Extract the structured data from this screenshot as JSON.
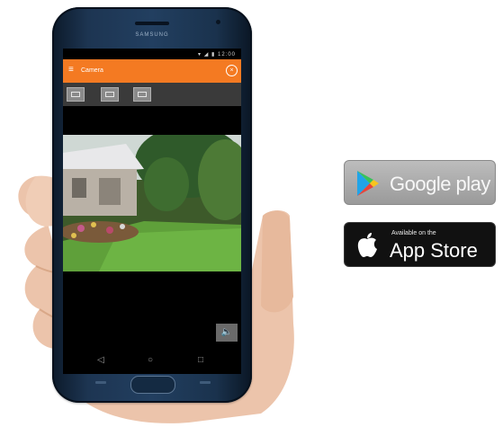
{
  "phone": {
    "brand": "SAMSUNG",
    "status_icons": "▾ ◢ ▮ 12:00",
    "app_bar": {
      "menu_icon": "menu-icon",
      "title": "Camera",
      "close_icon": "close-icon"
    },
    "toolbar": {
      "buttons": [
        "snapshot-button",
        "record-button",
        "fullscreen-button"
      ]
    },
    "video": {
      "description_icon": "live-camera-feed"
    },
    "mute_icon": "speaker-muted-icon",
    "nav": {
      "back": "◁",
      "home": "○",
      "recent": "□"
    }
  },
  "badges": {
    "google_play": {
      "big": "Google play"
    },
    "app_store": {
      "small": "Available on the",
      "big": "App Store"
    }
  },
  "colors": {
    "accent": "#f47a22",
    "phone_body": "#1d3552",
    "badge_dark": "#111111",
    "badge_grey": "#aaaaaa"
  }
}
